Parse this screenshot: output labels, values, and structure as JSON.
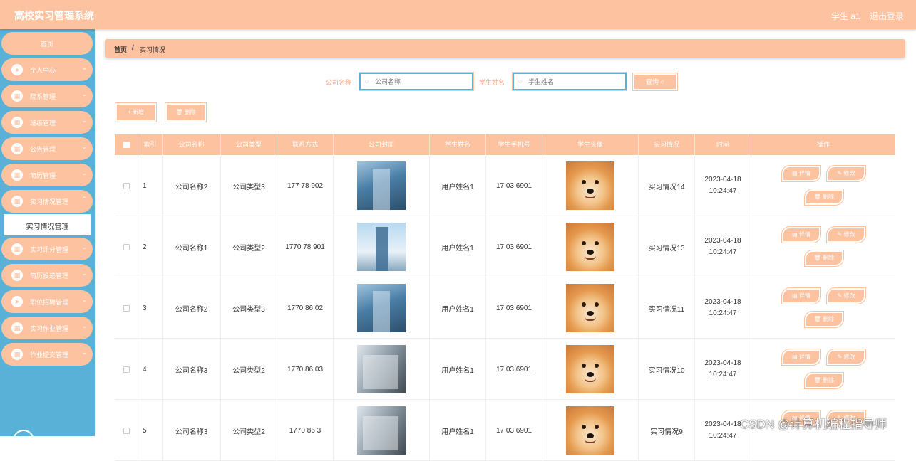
{
  "header": {
    "app_title": "高校实习管理系统",
    "user_label": "学生 a1",
    "logout_label": "退出登录"
  },
  "sidebar": {
    "home_label": "首页",
    "items": [
      {
        "label": "个人中心",
        "icon": "user-icon"
      },
      {
        "label": "院系管理",
        "icon": "grid-icon"
      },
      {
        "label": "班级管理",
        "icon": "grid-icon"
      },
      {
        "label": "公告管理",
        "icon": "grid-icon"
      },
      {
        "label": "简历管理",
        "icon": "grid-icon"
      },
      {
        "label": "实习情况管理",
        "icon": "grid-icon"
      },
      {
        "label": "实习评分管理",
        "icon": "grid-icon"
      },
      {
        "label": "简历投递管理",
        "icon": "grid-icon"
      },
      {
        "label": "职位招聘管理",
        "icon": "send-icon"
      },
      {
        "label": "实习作业管理",
        "icon": "grid-icon"
      },
      {
        "label": "作业提交管理",
        "icon": "grid-icon"
      }
    ],
    "active_submenu_label": "实习情况管理"
  },
  "breadcrumb": {
    "home": "首页",
    "separator": "/",
    "current": "实习情况"
  },
  "search": {
    "company_label": "公司名称",
    "company_placeholder": "公司名称",
    "student_label": "学生姓名",
    "student_placeholder": "学生姓名",
    "query_label": "查询 ○"
  },
  "toolbar": {
    "add_label": "+ 新增",
    "delete_label": "🗑 删除"
  },
  "table": {
    "columns": [
      "索引",
      "公司名称",
      "公司类型",
      "联系方式",
      "公司封面",
      "学生姓名",
      "学生手机号",
      "学生头像",
      "实习情况",
      "时间",
      "操作"
    ],
    "rows": [
      {
        "index": "1",
        "company": "公司名称2",
        "type": "公司类型3",
        "contact": "177  78  902",
        "student": "用户姓名1",
        "phone": "17  03   6901",
        "status": "实习情况14",
        "time": "2023-04-18 10:24:47"
      },
      {
        "index": "2",
        "company": "公司名称1",
        "type": "公司类型2",
        "contact": "1770  78  901",
        "student": "用户姓名1",
        "phone": "17  03   6901",
        "status": "实习情况13",
        "time": "2023-04-18 10:24:47"
      },
      {
        "index": "3",
        "company": "公司名称2",
        "type": "公司类型3",
        "contact": "1770   86  02",
        "student": "用户姓名1",
        "phone": "17  03   6901",
        "status": "实习情况11",
        "time": "2023-04-18 10:24:47"
      },
      {
        "index": "4",
        "company": "公司名称3",
        "type": "公司类型2",
        "contact": "1770   86  03",
        "student": "用户姓名1",
        "phone": "17  03   6901",
        "status": "实习情况10",
        "time": "2023-04-18 10:24:47"
      },
      {
        "index": "5",
        "company": "公司名称3",
        "type": "公司类型2",
        "contact": "1770   86  3",
        "student": "用户姓名1",
        "phone": "17  03   6901",
        "status": "实习情况9",
        "time": "2023-04-18 10:24:47"
      }
    ],
    "actions": {
      "detail": "▤ 详情",
      "edit": "✎ 修改",
      "delete": "🗑 删除"
    }
  },
  "watermark": "CSDN @计算机编程指导师",
  "colors": {
    "accent": "#fdc29f",
    "sidebar": "#5ab1d7"
  }
}
